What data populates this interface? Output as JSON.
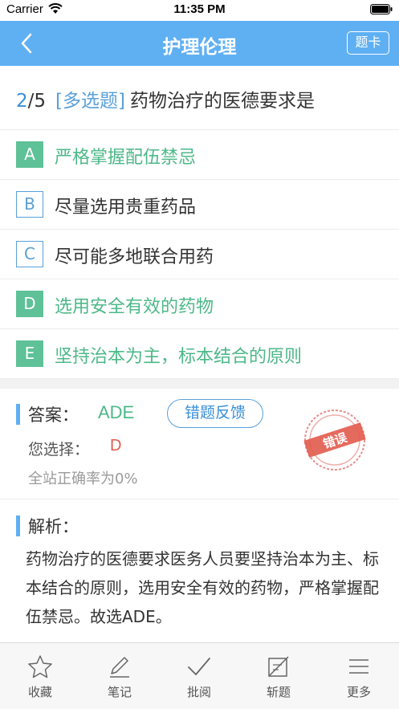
{
  "status_bar": {
    "carrier": "Carrier",
    "time": "11:35 PM"
  },
  "nav": {
    "title": "护理伦理",
    "card_button": "题卡"
  },
  "question": {
    "current": "2",
    "total": "/5",
    "type": "[多选题]",
    "text": "药物治疗的医德要求是"
  },
  "options": [
    {
      "letter": "A",
      "text": "严格掌握配伍禁忌",
      "correct": true
    },
    {
      "letter": "B",
      "text": "尽量选用贵重药品",
      "correct": false
    },
    {
      "letter": "C",
      "text": "尽可能多地联合用药",
      "correct": false
    },
    {
      "letter": "D",
      "text": "选用安全有效的药物",
      "correct": true
    },
    {
      "letter": "E",
      "text": "坚持治本为主，标本结合的原则",
      "correct": true
    }
  ],
  "answer": {
    "label": "答案：",
    "value": "ADE",
    "feedback_button": "错题反馈",
    "your_choice_label": "您选择：",
    "your_choice_value": "D",
    "accuracy_text": "全站正确率为0%",
    "stamp_text": "错误"
  },
  "analysis": {
    "label": "解析：",
    "text": "药物治疗的医德要求医务人员要坚持治本为主、标本结合的原则，选用安全有效的药物，严格掌握配伍禁忌。故选ADE。"
  },
  "tabs": [
    {
      "label": "收藏",
      "icon": "star-icon"
    },
    {
      "label": "笔记",
      "icon": "pencil-icon"
    },
    {
      "label": "批阅",
      "icon": "check-icon"
    },
    {
      "label": "斩题",
      "icon": "slash-icon"
    },
    {
      "label": "更多",
      "icon": "menu-icon"
    }
  ],
  "colors": {
    "nav_blue": "#5fb0f3",
    "correct_green": "#5ec197",
    "option_blue": "#5aa0d8",
    "error_red": "#e25a4c"
  }
}
